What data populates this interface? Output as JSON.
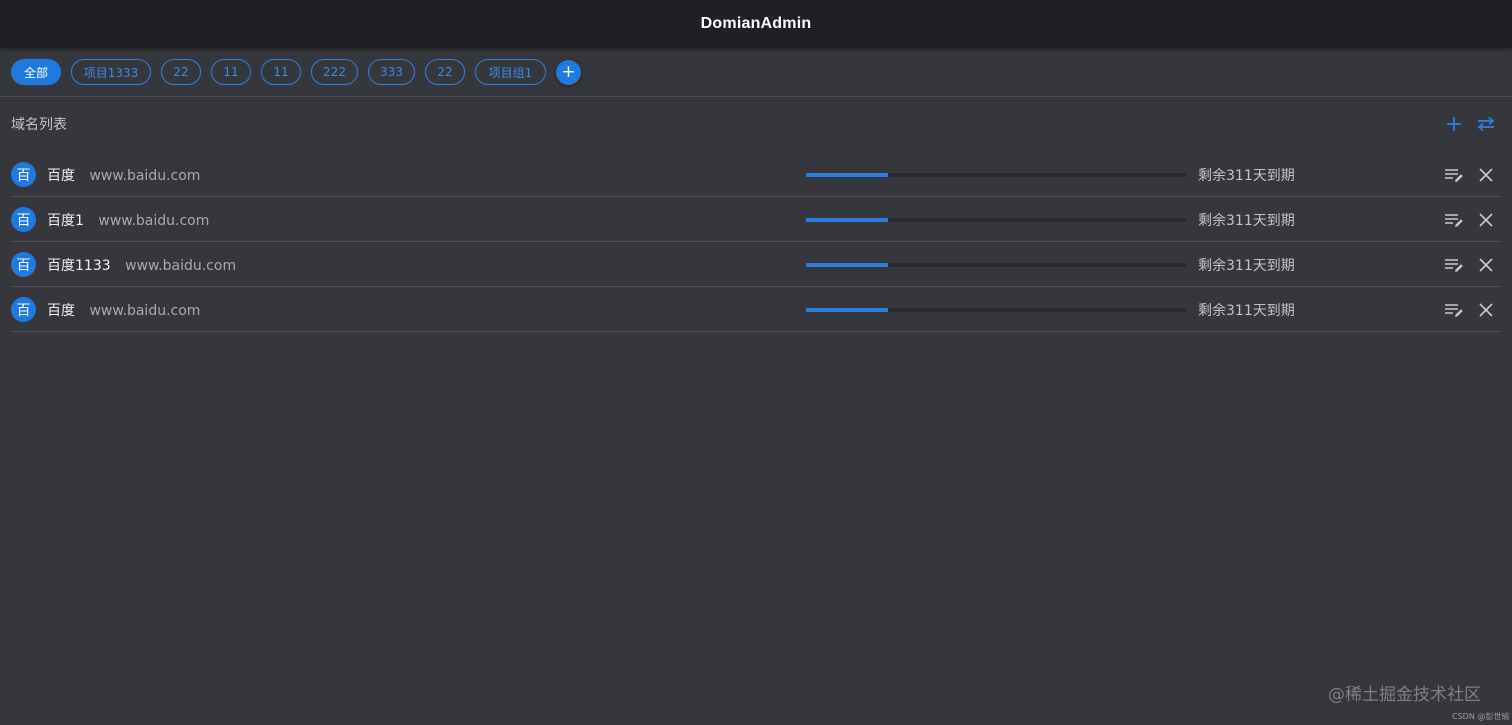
{
  "app": {
    "title": "DomianAdmin"
  },
  "colors": {
    "accent": "#1f7ae0",
    "background": "#36373c",
    "appbar": "#1f2024"
  },
  "chips": {
    "items": [
      {
        "label": "全部",
        "active": true
      },
      {
        "label": "项目1333",
        "active": false
      },
      {
        "label": "22",
        "active": false
      },
      {
        "label": "11",
        "active": false
      },
      {
        "label": "11",
        "active": false
      },
      {
        "label": "222",
        "active": false
      },
      {
        "label": "333",
        "active": false
      },
      {
        "label": "22",
        "active": false
      },
      {
        "label": "项目组1",
        "active": false
      }
    ],
    "add_label": "+",
    "add_icon": "plus-icon"
  },
  "section": {
    "title": "域名列表",
    "add_icon": "plus-icon",
    "swap_icon": "swap-horizontal-icon"
  },
  "domains": [
    {
      "avatar": "百",
      "name": "百度",
      "url": "www.baidu.com",
      "progress_pct": 21.5,
      "expiry": "剩余311天到期"
    },
    {
      "avatar": "百",
      "name": "百度1",
      "url": "www.baidu.com",
      "progress_pct": 21.5,
      "expiry": "剩余311天到期"
    },
    {
      "avatar": "百",
      "name": "百度1133",
      "url": "www.baidu.com",
      "progress_pct": 21.5,
      "expiry": "剩余311天到期"
    },
    {
      "avatar": "百",
      "name": "百度",
      "url": "www.baidu.com",
      "progress_pct": 21.5,
      "expiry": "剩余311天到期"
    }
  ],
  "row_icons": {
    "edit": "edit-list-icon",
    "delete": "close-icon"
  },
  "watermark": {
    "main": "@稀土掘金技术社区",
    "sub": "CSDN @彭世瑜"
  }
}
